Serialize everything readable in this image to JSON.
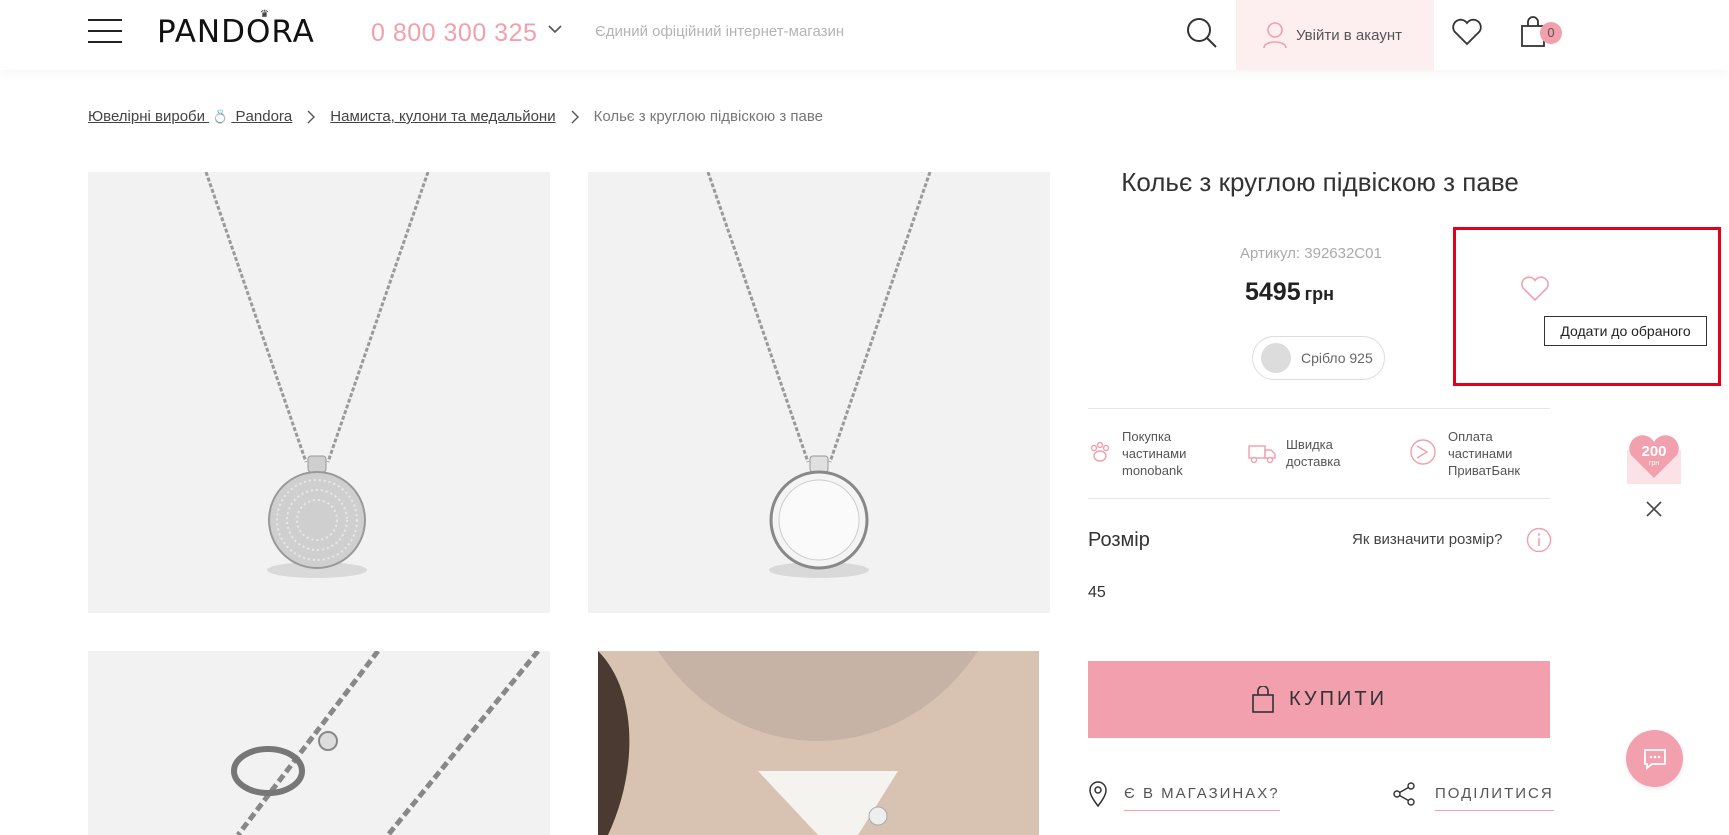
{
  "header": {
    "logo": "PANDORA",
    "phone": "0 800 300 325",
    "tagline": "Єдиний офіційний інтернет-магазин",
    "account_label": "Увійти в акаунт",
    "cart_count": "0"
  },
  "breadcrumb": {
    "item1_pre": "Ювелірні вироби",
    "item1_post": "Pandora",
    "item2": "Намиста, кулони та медальйони",
    "current": "Кольє з круглою підвіскою з паве"
  },
  "product": {
    "title": "Кольє з круглою підвіскою з паве",
    "sku": "Артикул: 392632C01",
    "price": "5495",
    "currency": "грн",
    "material": "Срібло 925",
    "favorite_tooltip": "Додати до обраного",
    "features": [
      {
        "icon": "paw-icon",
        "text": "Покупка частинами monobank"
      },
      {
        "icon": "truck-icon",
        "text": "Швидка доставка"
      },
      {
        "icon": "privat-icon",
        "text": "Оплата частинами ПриватБанк"
      }
    ],
    "size_label": "Розмір",
    "size_help": "Як визначити розмір?",
    "size_value": "45",
    "buy_label": "КУПИТИ",
    "store_label": "Є В МАГАЗИНАХ?",
    "share_label": "ПОДІЛИТИСЯ"
  },
  "promo": {
    "amount": "200",
    "currency": "грн"
  },
  "colors": {
    "accent_pink": "#f2a0ad",
    "highlight_red": "#e2001a"
  }
}
